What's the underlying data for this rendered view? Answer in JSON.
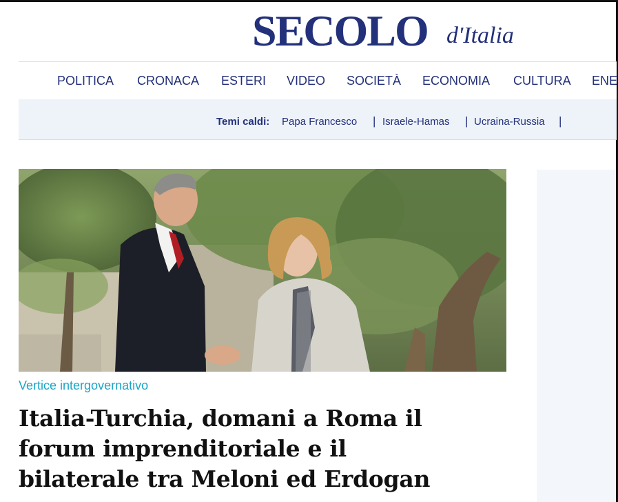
{
  "logo": {
    "main": "SECOLO",
    "sub": "d'Italia"
  },
  "nav": {
    "items": [
      {
        "label": "POLITICA"
      },
      {
        "label": "CRONACA"
      },
      {
        "label": "ESTERI"
      },
      {
        "label": "VIDEO"
      },
      {
        "label": "SOCIETÀ"
      },
      {
        "label": "ECONOMIA"
      },
      {
        "label": "CULTURA"
      },
      {
        "label": "ENE"
      }
    ]
  },
  "hot_topics": {
    "label": "Temi caldi:",
    "links": [
      {
        "label": "Papa Francesco"
      },
      {
        "label": "Israele-Hamas"
      },
      {
        "label": "Ucraina-Russia"
      }
    ],
    "separator": "|"
  },
  "article": {
    "category": "Vertice intergovernativo",
    "headline_lines": [
      "Italia-Turchia, domani a Roma il",
      "forum imprenditoriale e il",
      "bilaterale tra Meloni ed Erdogan"
    ]
  },
  "colors": {
    "brand_navy": "#23307a",
    "category_cyan": "#1aa6c9",
    "hotbar_bg": "#eef3fa"
  }
}
